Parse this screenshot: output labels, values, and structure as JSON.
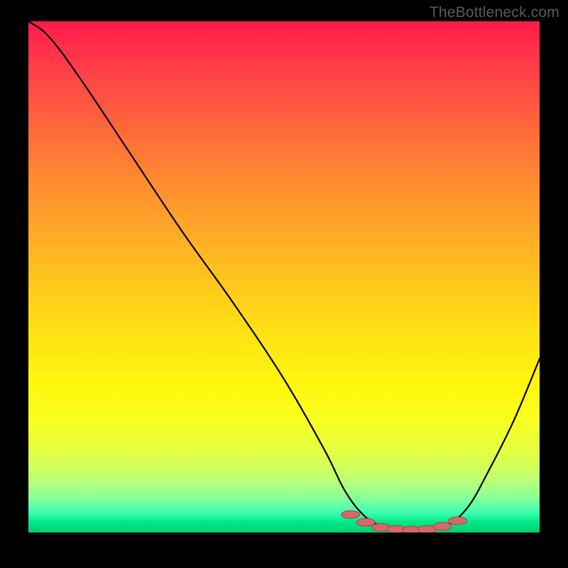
{
  "watermark": "TheBottleneck.com",
  "colors": {
    "background": "#000000",
    "curve": "#000000",
    "marker_fill": "#d66868",
    "marker_stroke": "#a04848"
  },
  "chart_data": {
    "type": "line",
    "title": "",
    "xlabel": "",
    "ylabel": "",
    "xlim": [
      0,
      100
    ],
    "ylim": [
      0,
      100
    ],
    "description": "Bottleneck curve — V-shaped profile where y=100 is worst (red) and y=0 is optimal (green). Minimum/optimal region around x≈68–82.",
    "series": [
      {
        "name": "bottleneck-curve",
        "x": [
          0,
          4,
          10,
          20,
          30,
          40,
          50,
          58,
          62,
          66,
          70,
          74,
          78,
          82,
          86,
          90,
          95,
          100
        ],
        "y": [
          100,
          97,
          89,
          74,
          59,
          45,
          30,
          16,
          8,
          3,
          1,
          0.5,
          0.5,
          1.5,
          5,
          12,
          22,
          34
        ]
      }
    ],
    "markers": {
      "name": "optimal-range",
      "x": [
        63,
        66,
        69,
        72,
        75,
        78,
        81,
        84
      ],
      "y": [
        3.5,
        2,
        1,
        0.6,
        0.5,
        0.6,
        1.2,
        2.3
      ]
    }
  }
}
